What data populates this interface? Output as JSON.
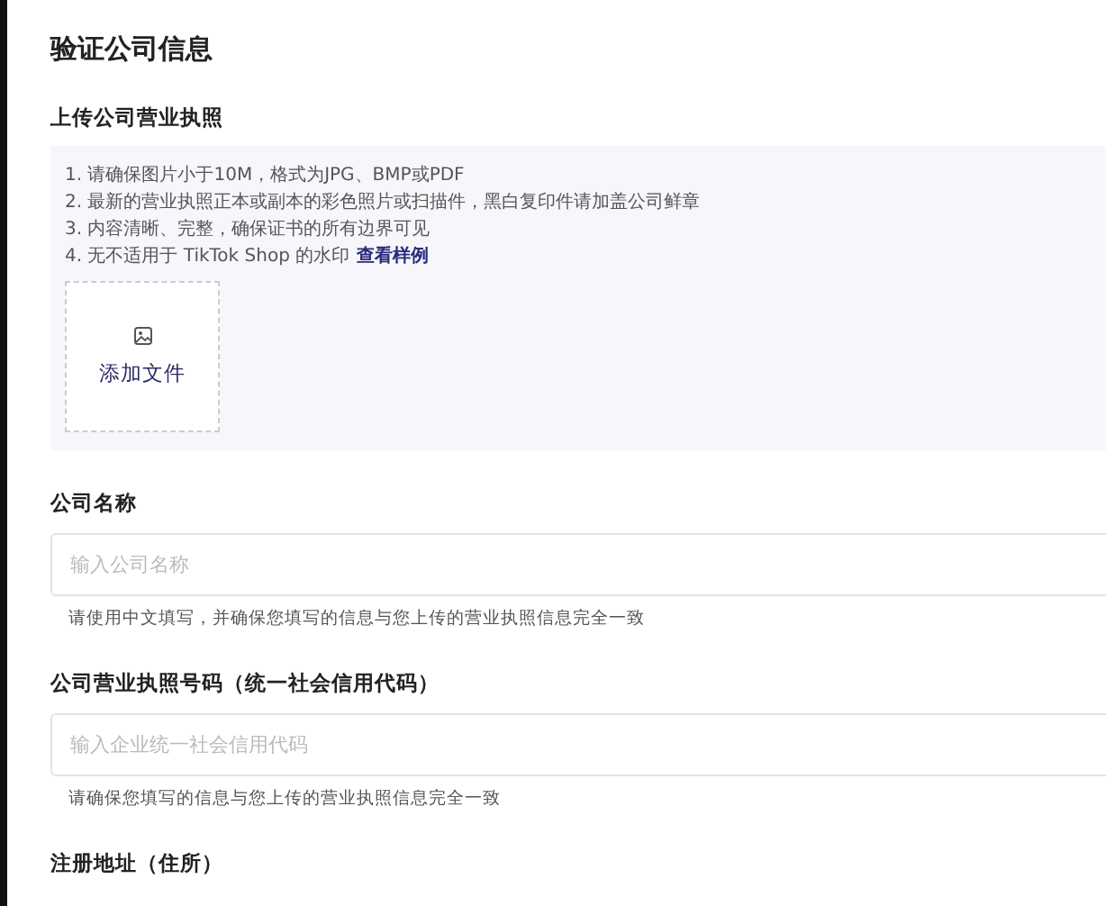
{
  "page_title": "验证公司信息",
  "upload": {
    "label": "上传公司营业执照",
    "requirements": [
      "1. 请确保图片小于10M，格式为JPG、BMP或PDF",
      "2. 最新的营业执照正本或副本的彩色照片或扫描件，黑白复印件请加盖公司鲜章",
      "3. 内容清晰、完整，确保证书的所有边界可见",
      "4. 无不适用于 TikTok Shop 的水印"
    ],
    "example_link": "查看样例",
    "add_button": "添加文件"
  },
  "fields": [
    {
      "label": "公司名称",
      "placeholder": "输入公司名称",
      "help": "请使用中文填写，并确保您填写的信息与您上传的营业执照信息完全一致"
    },
    {
      "label": "公司营业执照号码（统一社会信用代码）",
      "placeholder": "输入企业统一社会信用代码",
      "help": "请确保您填写的信息与您上传的营业执照信息完全一致"
    }
  ],
  "next_label": "注册地址（住所）"
}
